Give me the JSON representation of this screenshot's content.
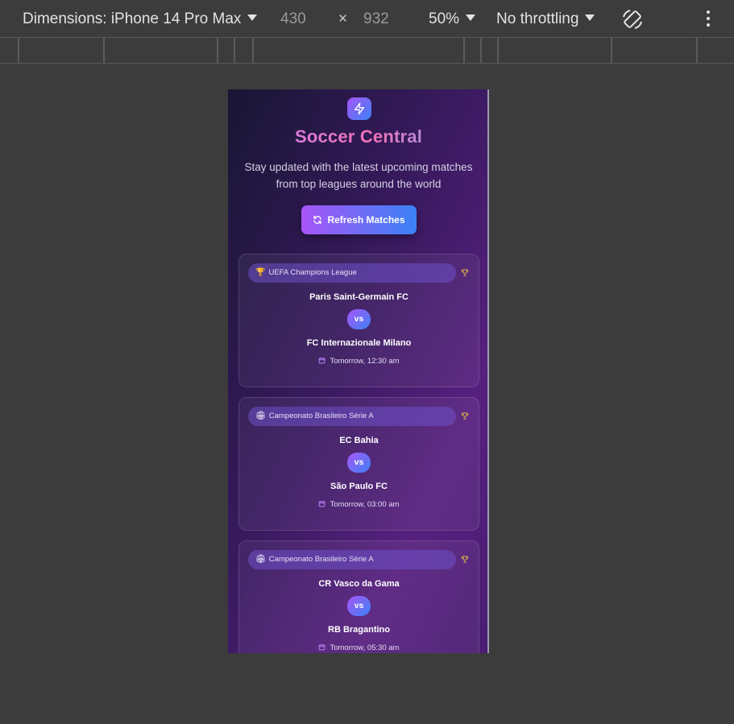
{
  "devtools": {
    "dimensions_label": "Dimensions: iPhone 14 Pro Max",
    "width": "430",
    "times": "×",
    "height": "932",
    "zoom": "50%",
    "throttling": "No throttling"
  },
  "app": {
    "title": "Soccer Central",
    "subtitle": "Stay updated with the latest upcoming matches from top leagues around the world",
    "refresh_label": "Refresh Matches"
  },
  "matches": [
    {
      "league_emoji": "🏆",
      "league": "UEFA Champions League",
      "home": "Paris Saint-Germain FC",
      "vs": "vs",
      "away": "FC Internazionale Milano",
      "time": "Tomorrow, 12:30 am"
    },
    {
      "league_emoji": "🏟",
      "league": "Campeonato Brasileiro Série A",
      "home": "EC Bahia",
      "vs": "vs",
      "away": "São Paulo FC",
      "time": "Tomorrow, 03:00 am"
    },
    {
      "league_emoji": "🏟",
      "league": "Campeonato Brasileiro Série A",
      "home": "CR Vasco da Gama",
      "vs": "vs",
      "away": "RB Bragantino",
      "time": "Tomorrow, 05:30 am"
    }
  ],
  "colors": {
    "accent_from": "#a855f7",
    "accent_to": "#3b82f6",
    "trophy": "#d4a94a"
  },
  "icons": {
    "logo": "lightning-icon",
    "refresh": "refresh-icon",
    "league": "trophy-icon",
    "time": "calendar-icon"
  }
}
